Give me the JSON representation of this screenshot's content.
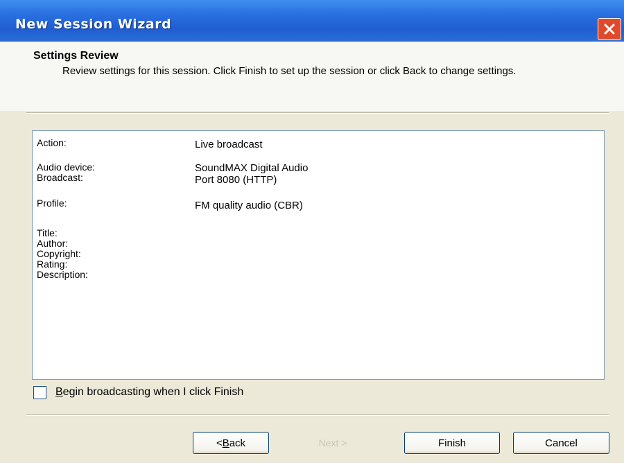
{
  "window": {
    "title": "New Session Wizard"
  },
  "header": {
    "title": "Settings Review",
    "description": "Review settings for this session. Click Finish to set up the session or click Back to change settings."
  },
  "review": {
    "rows": [
      {
        "label": "Action:",
        "value": "Live broadcast"
      },
      {
        "label": "Audio device:",
        "value": "SoundMAX Digital Audio"
      },
      {
        "label": "Broadcast:",
        "value": "Port 8080 (HTTP)"
      },
      {
        "label": "Profile:",
        "value": "FM quality audio (CBR)"
      },
      {
        "label": "Title:",
        "value": ""
      },
      {
        "label": "Author:",
        "value": ""
      },
      {
        "label": "Copyright:",
        "value": ""
      },
      {
        "label": "Rating:",
        "value": ""
      },
      {
        "label": "Description:",
        "value": ""
      }
    ]
  },
  "options": {
    "begin_broadcasting": {
      "label_accesskey": "B",
      "label_rest": "egin broadcasting when I click Finish",
      "checked": false
    }
  },
  "buttons": {
    "back": {
      "prefix": "< ",
      "accesskey": "B",
      "rest": "ack"
    },
    "next": {
      "label": "Next >",
      "enabled": false
    },
    "finish": {
      "label": "Finish"
    },
    "cancel": {
      "label": "Cancel"
    }
  },
  "colors": {
    "titlebar": "#2a6fe0",
    "close": "#e04a2c",
    "dialog_bg": "#ece9d8"
  }
}
